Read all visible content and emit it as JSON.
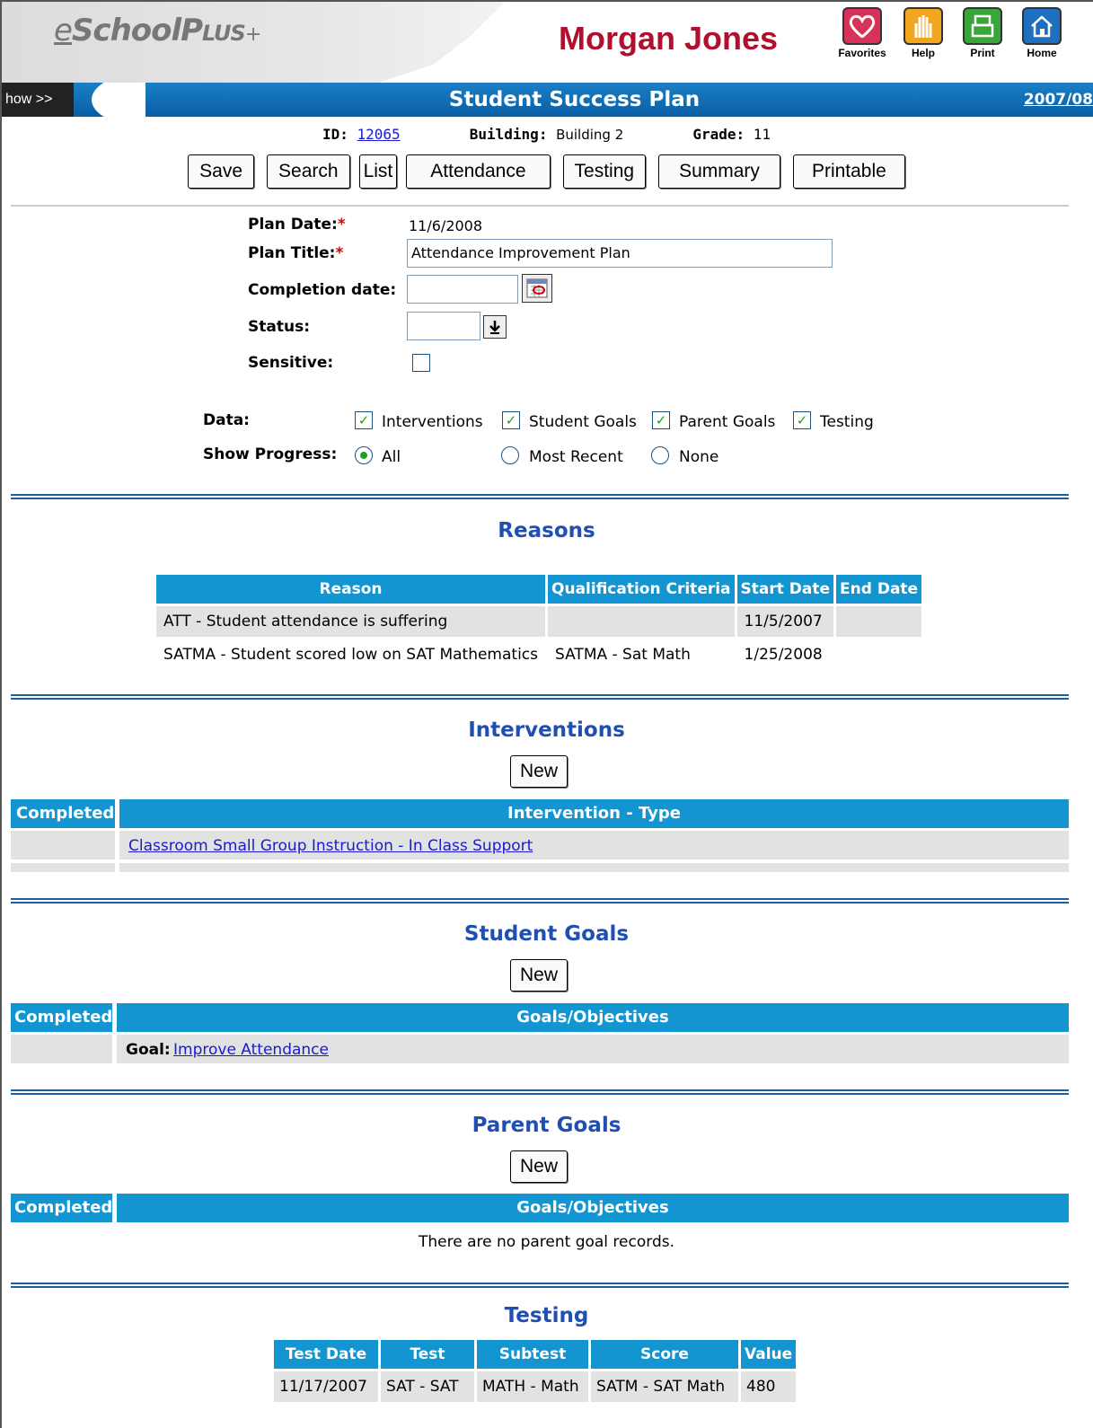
{
  "header": {
    "logo_e": "e",
    "logo_school": "School",
    "logo_plus_caps": "Plus",
    "logo_plus_sign": "+",
    "student_name": "Morgan Jones",
    "icons": {
      "favorites": "Favorites",
      "help": "Help",
      "print": "Print",
      "home": "Home"
    },
    "icon_names": [
      "heart-icon",
      "hand-icon",
      "printer-icon",
      "house-icon"
    ],
    "icon_colors": {
      "favorites": "#d9325a",
      "help": "#f2a51e",
      "print": "#3aa63a",
      "home": "#1f6fc0"
    }
  },
  "bluebar": {
    "show": "how >>",
    "title": "Student Success Plan",
    "year": "2007/08"
  },
  "info": {
    "id_label": "ID:",
    "id_value": "12065",
    "building_label": "Building:",
    "building_value": "Building 2",
    "grade_label": "Grade:",
    "grade_value": "11"
  },
  "toolbar": [
    "Save",
    "Search",
    "List",
    "Attendance",
    "Testing",
    "Summary",
    "Printable"
  ],
  "form": {
    "plan_date_label": "Plan Date:",
    "plan_date_value": "11/6/2008",
    "plan_title_label": "Plan Title:",
    "plan_title_value": "Attendance Improvement Plan",
    "completion_label": "Completion date:",
    "completion_value": "",
    "status_label": "Status:",
    "status_value": "",
    "sensitive_label": "Sensitive:",
    "required_mark": "*",
    "data_label": "Data:",
    "data_options": [
      {
        "label": "Interventions",
        "checked": true
      },
      {
        "label": "Student Goals",
        "checked": true
      },
      {
        "label": "Parent Goals",
        "checked": true
      },
      {
        "label": "Testing",
        "checked": true
      }
    ],
    "progress_label": "Show Progress:",
    "progress_options": [
      {
        "label": "All",
        "selected": true
      },
      {
        "label": "Most Recent",
        "selected": false
      },
      {
        "label": "None",
        "selected": false
      }
    ]
  },
  "reasons": {
    "title": "Reasons",
    "headers": [
      "Reason",
      "Qualification Criteria",
      "Start Date",
      "End Date"
    ],
    "rows": [
      [
        "ATT - Student attendance is suffering",
        "",
        "11/5/2007",
        ""
      ],
      [
        "SATMA - Student scored low on SAT Mathematics",
        "SATMA - Sat Math",
        "1/25/2008",
        ""
      ]
    ]
  },
  "interventions": {
    "title": "Interventions",
    "new_label": "New",
    "headers": [
      "Completed",
      "Intervention - Type"
    ],
    "row_link": "Classroom Small Group Instruction - In Class Support"
  },
  "student_goals": {
    "title": "Student Goals",
    "new_label": "New",
    "headers": [
      "Completed",
      "Goals/Objectives"
    ],
    "goal_label": "Goal:",
    "goal_link": "Improve Attendance"
  },
  "parent_goals": {
    "title": "Parent Goals",
    "new_label": "New",
    "headers": [
      "Completed",
      "Goals/Objectives"
    ],
    "empty_text": "There are no parent goal records."
  },
  "testing": {
    "title": "Testing",
    "headers": [
      "Test Date",
      "Test",
      "Subtest",
      "Score",
      "Value"
    ],
    "rows": [
      [
        "11/17/2007",
        "SAT - SAT",
        "MATH - Math",
        "SATM - SAT Math",
        "480"
      ]
    ]
  }
}
